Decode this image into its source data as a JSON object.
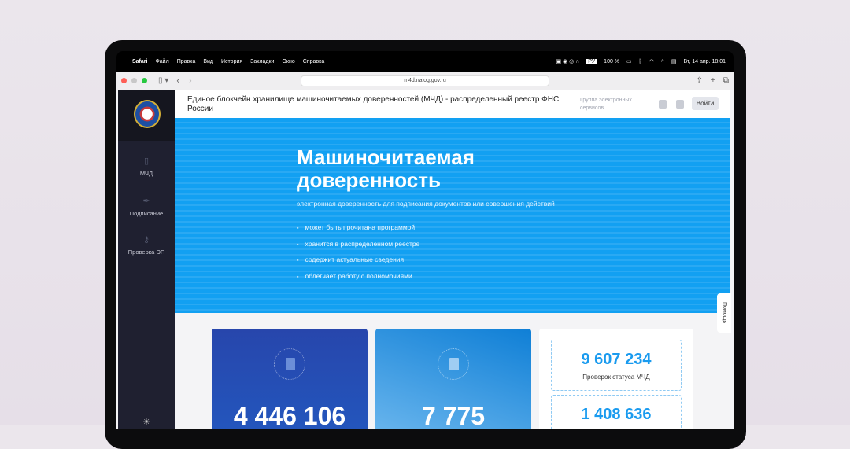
{
  "menubar": {
    "app": "Safari",
    "items": [
      "Файл",
      "Правка",
      "Вид",
      "История",
      "Закладки",
      "Окно",
      "Справка"
    ],
    "lang": "РУ",
    "battery": "100 %",
    "datetime": "Вт, 14 апр.  18:01"
  },
  "browser": {
    "url": "m4d.nalog.gov.ru"
  },
  "header": {
    "title": "Единое блокчейн хранилище машиночитаемых доверенностей (МЧД) - распределенный реестр ФНС России",
    "group": "Группа электронных сервисов",
    "login": "Войти"
  },
  "sidebar": {
    "items": [
      {
        "label": "МЧД"
      },
      {
        "label": "Подписание"
      },
      {
        "label": "Проверка ЭП"
      }
    ]
  },
  "hero": {
    "title": "Машиночитаемая доверенность",
    "subtitle": "электронная доверенность для подписания документов или совершения действий",
    "bullets": [
      "может быть прочитана программой",
      "хранится в распределенном реестре",
      "содержит актуальные сведения",
      "облегчает работу с полномочиями"
    ]
  },
  "help": "Помощь",
  "cards": [
    {
      "value": "4 446 106"
    },
    {
      "value": "7 775"
    }
  ],
  "stats": [
    {
      "value": "9 607 234",
      "label": "Проверок статуса МЧД"
    },
    {
      "value": "1 408 636"
    }
  ]
}
